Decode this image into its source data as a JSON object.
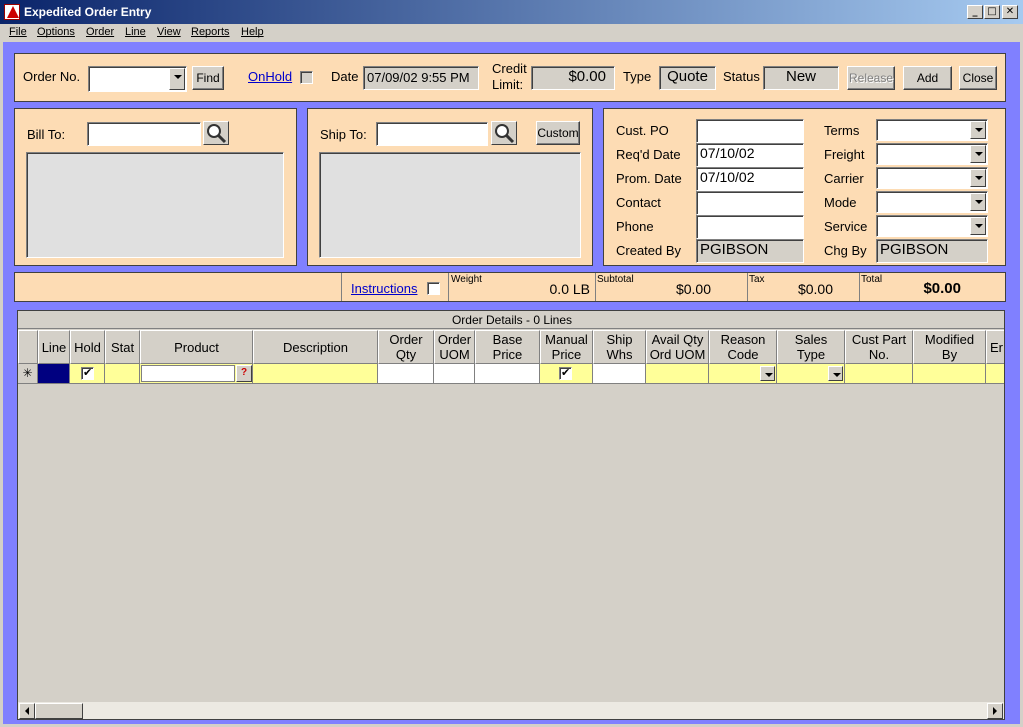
{
  "window": {
    "title": "Expedited Order Entry"
  },
  "menu": [
    "File",
    "Options",
    "Order",
    "Line",
    "View",
    "Reports",
    "Help"
  ],
  "header": {
    "order_no_label": "Order No.",
    "order_no_value": "",
    "find_label": "Find",
    "onhold_label": "OnHold",
    "date_label": "Date",
    "date_value": "07/09/02 9:55 PM",
    "credit_label_1": "Credit",
    "credit_label_2": "Limit:",
    "credit_value": "$0.00",
    "type_label": "Type",
    "type_value": "Quote",
    "status_label": "Status",
    "status_value": "New",
    "release_label": "Release",
    "add_label": "Add",
    "close_label": "Close"
  },
  "bill_to": {
    "label": "Bill To:",
    "value": ""
  },
  "ship_to": {
    "label": "Ship To:",
    "value": "",
    "custom_label": "Custom"
  },
  "details": {
    "cust_po_label": "Cust. PO",
    "cust_po_value": "",
    "reqd_date_label": "Req'd Date",
    "reqd_date_value": "07/10/02",
    "prom_date_label": "Prom. Date",
    "prom_date_value": "07/10/02",
    "contact_label": "Contact",
    "contact_value": "",
    "phone_label": "Phone",
    "phone_value": "",
    "created_by_label": "Created By",
    "created_by_value": "PGIBSON",
    "terms_label": "Terms",
    "freight_label": "Freight",
    "carrier_label": "Carrier",
    "mode_label": "Mode",
    "service_label": "Service",
    "chg_by_label": "Chg By",
    "chg_by_value": "PGIBSON"
  },
  "summary": {
    "instructions_label": "Instructions",
    "weight_label": "Weight",
    "weight_value": "0.0 LB",
    "subtotal_label": "Subtotal",
    "subtotal_value": "$0.00",
    "tax_label": "Tax",
    "tax_value": "$0.00",
    "total_label": "Total",
    "total_value": "$0.00"
  },
  "grid": {
    "caption": "Order Details -  0 Lines",
    "columns": [
      "Line",
      "Hold",
      "Stat",
      "Product",
      "Description",
      "Order\nQty",
      "Order\nUOM",
      "Base\nPrice",
      "Manual\nPrice",
      "Ship\nWhs",
      "Avail Qty\nOrd UOM",
      "Reason\nCode",
      "Sales\nType",
      "Cust Part\nNo.",
      "Modified\nBy",
      "Er"
    ],
    "new_row_marker": "✳"
  },
  "colors": {
    "client_bg": "#8080ff",
    "panel_bg": "#fddcb4",
    "row_yellow": "#ffff99",
    "title_blue": "#0a246a"
  }
}
